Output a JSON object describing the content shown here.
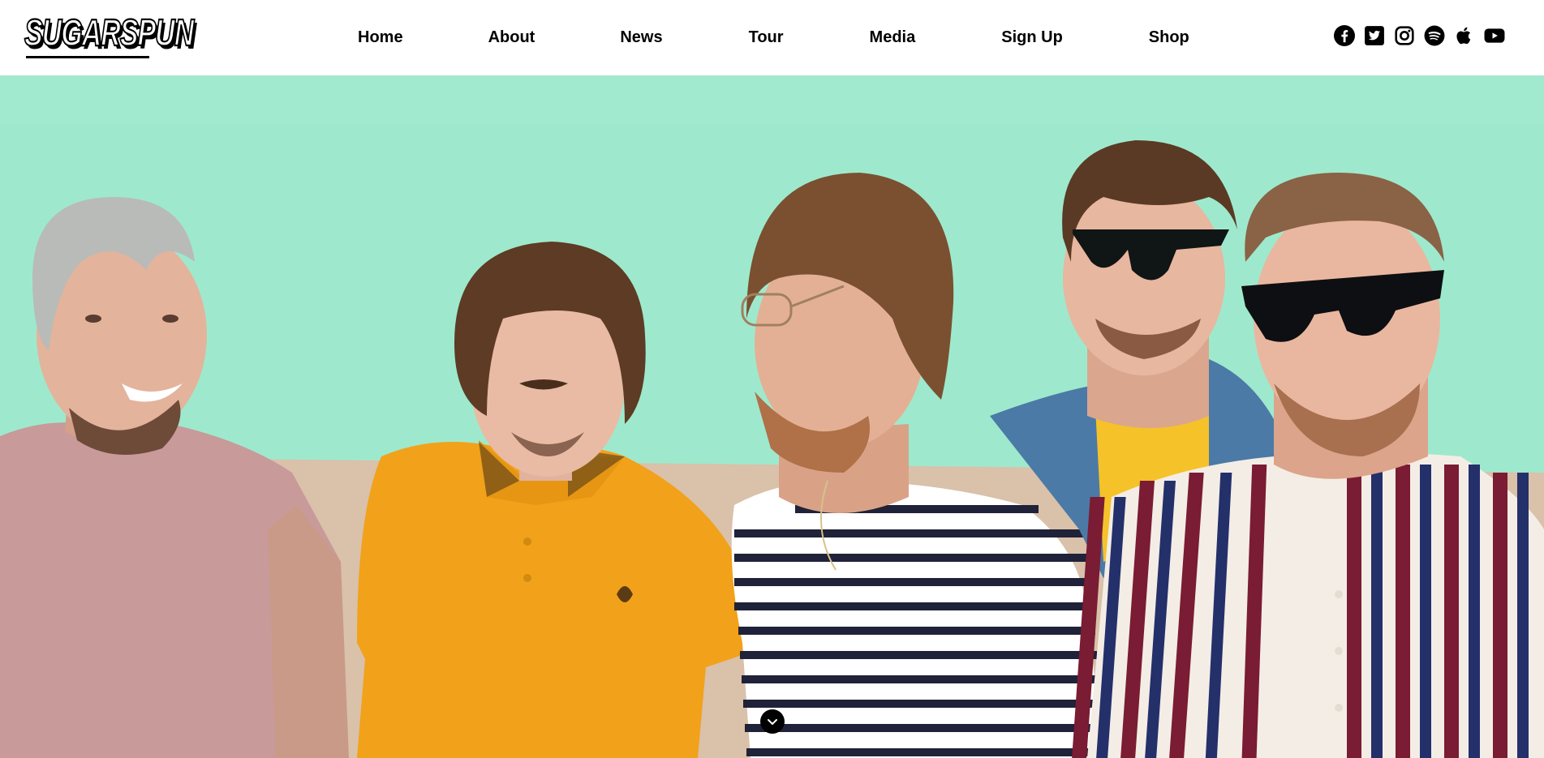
{
  "site": {
    "logo_text": "SUGARSPUN"
  },
  "nav": {
    "items": [
      {
        "label": "Home"
      },
      {
        "label": "About"
      },
      {
        "label": "News"
      },
      {
        "label": "Tour"
      },
      {
        "label": "Media"
      },
      {
        "label": "Sign Up"
      },
      {
        "label": "Shop"
      }
    ]
  },
  "social": [
    {
      "name": "facebook-icon"
    },
    {
      "name": "twitter-icon"
    },
    {
      "name": "instagram-icon"
    },
    {
      "name": "spotify-icon"
    },
    {
      "name": "apple-music-icon"
    },
    {
      "name": "youtube-icon"
    }
  ],
  "hero": {
    "image": "band-photo",
    "scroll_icon": "chevron-down-icon"
  },
  "colors": {
    "wall": "#9ee9cd",
    "ground": "#d9c1aa",
    "text": "#000000",
    "header_bg": "#ffffff"
  }
}
